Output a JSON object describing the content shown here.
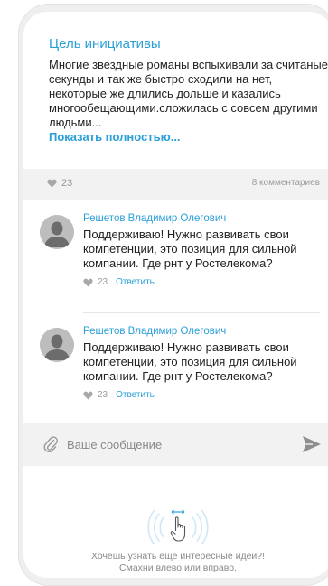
{
  "goal": {
    "title": "Цель инициативы",
    "text": "Многие звездные романы вспыхивали за считаные секунды и так же быстро сходили на нет, некоторые же длились дольше и казались многообещающими.сложилась с совсем другими людьми...",
    "more_label": "Показать полностью..."
  },
  "stats": {
    "likes": "23",
    "comments": "8 комментариев",
    "like_icon": "heart-icon"
  },
  "comments": [
    {
      "author": "Решетов Владимир Олегович",
      "text": "Поддерживаю! Нужно развивать свои компетенции, это позиция для сильной компании. Где рнт у Ростелекома?",
      "likes": "23",
      "reply_label": "Ответить"
    },
    {
      "author": "Решетов Владимир Олегович",
      "text": "Поддерживаю! Нужно развивать свои компетенции, это позиция для сильной компании. Где рнт у Ростелекома?",
      "likes": "23",
      "reply_label": "Ответить"
    }
  ],
  "composer": {
    "placeholder": "Ваше сообщение",
    "attach_icon": "paperclip-icon",
    "send_icon": "send-icon"
  },
  "swipe_hint": {
    "line1": "Хочешь узнать еще интересные идеи?!",
    "line2": "Смахни влево или вправо.",
    "icon": "swipe-hand-icon"
  },
  "colors": {
    "accent": "#2a9fd8",
    "text": "#222222",
    "muted": "#9a9a9a",
    "panel": "#f2f2f2"
  }
}
